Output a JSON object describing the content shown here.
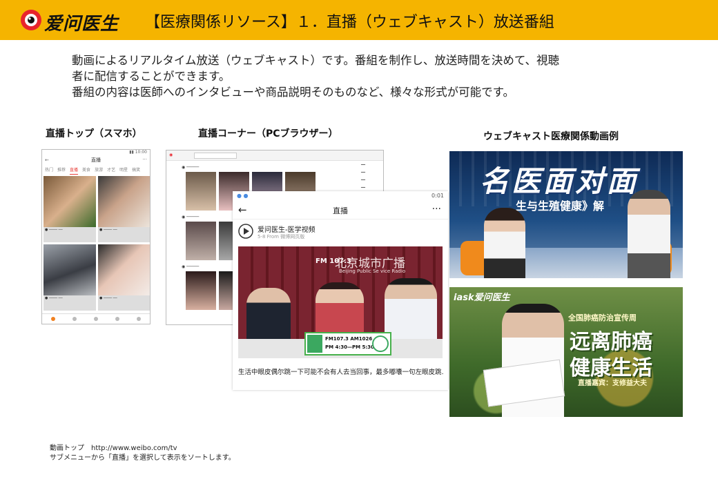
{
  "header": {
    "logo_text": "爱问医生",
    "title": "【医療関係リソース】１．直播（ウェブキャスト）放送番組",
    "bg_color": "#f5b400"
  },
  "intro": {
    "line1": "動画によるリアルタイム放送（ウェブキャスト）です。番組を制作し、放送時間を決めて、視聴",
    "line2": "者に配信することができます。",
    "line3": "番組の内容は医師へのインタビューや商品説明そのものなど、様々な形式が可能です。"
  },
  "captions": {
    "phone": "直播トップ（スマホ）",
    "pc": "直播コーナー（PCブラウザー）",
    "examples": "ウェブキャスト医療関係動画例"
  },
  "phone_shot": {
    "title": "直播",
    "tabs": [
      "热门",
      "推荐",
      "直播",
      "美食",
      "旅游",
      "才艺",
      "明星",
      "搞笑"
    ],
    "active_tab": "直播"
  },
  "overlay": {
    "status_time": "0:01",
    "nav_title": "直播",
    "more": "···",
    "back": "←",
    "account": "爱问医生-医学视频",
    "meta": "5-8  From 微博网页版",
    "studio_sign": "北京城市广播",
    "studio_sub": "Beijing Public Se vice Radio",
    "fm_logo": "FM 107.3",
    "banner_freq1": "FM107.3   AM1026",
    "banner_freq2": "PM 4:30—PM 5:30",
    "caption": "生活中眼皮偶尔跳一下可能不会有人去当回事，最多嘟囔一句左眼皮跳…"
  },
  "example1": {
    "title": "名医面对面",
    "subtitle": "生与生殖健康》解"
  },
  "example2": {
    "brand": "iask爱问医生",
    "top_line": "全国肺癌防治宣传周",
    "line1": "远离肺癌",
    "line2": "健康生活",
    "guest": "直播嘉宾：支修益大夫"
  },
  "footer": {
    "line1": "動画トップ　http://www.weibo.com/tv",
    "line2": "サブメニューから「直播」を選択して表示をソートします。"
  }
}
